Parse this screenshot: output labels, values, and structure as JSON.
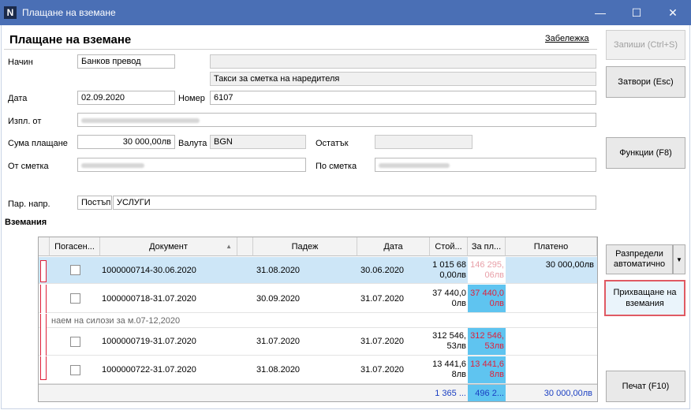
{
  "window": {
    "title": "Плащане на вземане",
    "app_icon_letter": "N",
    "minimize": "—",
    "maximize": "☐",
    "close": "✕"
  },
  "form": {
    "title": "Плащане на вземане",
    "note_link": "Забележка",
    "method_label": "Начин",
    "method_value": "Банков превод",
    "fee_value": "Такси за сметка на наредителя",
    "date_label": "Дата",
    "date_value": "02.09.2020",
    "number_label": "Номер",
    "number_value": "6107",
    "payer_label": "Изпл. от",
    "amount_label": "Сума плащане",
    "amount_value": "30 000,00лв",
    "currency_label": "Валута",
    "currency_value": "BGN",
    "remainder_label": "Остатък",
    "from_account_label": "От сметка",
    "to_account_label": "По сметка",
    "flow_label": "Пар. напр.",
    "flow_code": "Постъп",
    "flow_value": "УСЛУГИ",
    "section_label": "Вземания"
  },
  "buttons": {
    "save": "Запиши (Ctrl+S)",
    "close": "Затвори (Esc)",
    "functions": "Функции (F8)",
    "distribute": "Разпредели автоматично",
    "accept": "Прихващане на вземания",
    "print": "Печат (F10)"
  },
  "grid": {
    "columns": [
      "Погасен...",
      "Документ",
      "Падеж",
      "Дата",
      "Стой...",
      "За пл...",
      "Платено"
    ],
    "rows": [
      {
        "document": "1000000714-30.06.2020",
        "due": "31.08.2020",
        "date": "30.06.2020",
        "value_1": "1 015 68",
        "value_2": "0,00лв",
        "pay_1": "146 295,",
        "pay_2": "06лв",
        "paid": "30 000,00лв",
        "selected": true
      },
      {
        "document": "1000000718-31.07.2020",
        "due": "30.09.2020",
        "date": "31.07.2020",
        "value_1": "37 440,0",
        "value_2": "0лв",
        "pay_1": "37 440,0",
        "pay_2": "0лв",
        "paid": "",
        "selected": false
      },
      {
        "document": "1000000719-31.07.2020",
        "due": "31.07.2020",
        "date": "31.07.2020",
        "value_1": "312 546,",
        "value_2": "53лв",
        "pay_1": "312 546,",
        "pay_2": "53лв",
        "paid": "",
        "selected": false
      },
      {
        "document": "1000000722-31.07.2020",
        "due": "31.08.2020",
        "date": "31.07.2020",
        "value_1": "13 441,6",
        "value_2": "8лв",
        "pay_1": "13 441,6",
        "pay_2": "8лв",
        "paid": "",
        "selected": false
      }
    ],
    "group_note": "наем на силози за м.07-12,2020",
    "totals": {
      "value": "1 365 ...",
      "pay": "496 2...",
      "paid": "30 000,00лв"
    }
  },
  "colors": {
    "titlebar": "#4a6fb5",
    "highlight_column": "#5fc4f0",
    "accent_red": "#e0203a",
    "totals_blue": "#1a3fc2"
  }
}
